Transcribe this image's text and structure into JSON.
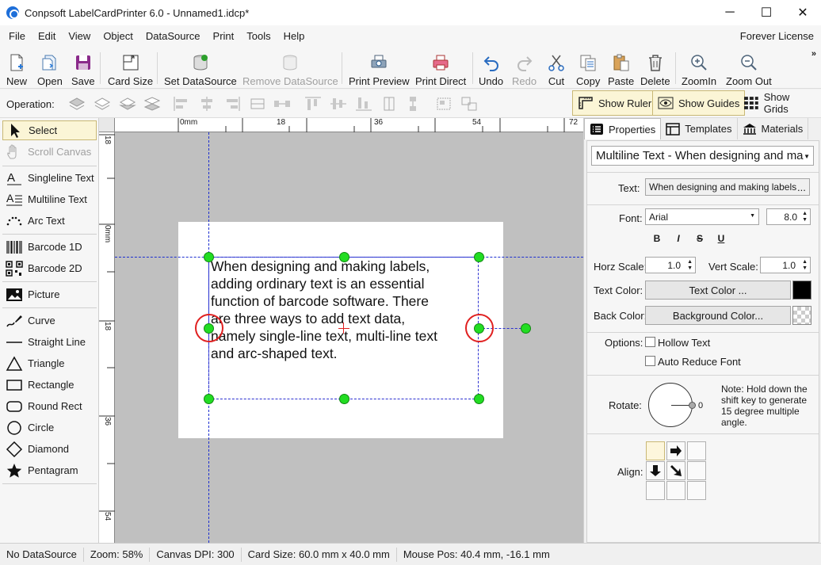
{
  "window": {
    "title": "Conpsoft LabelCardPrinter 6.0 - Unnamed1.idcp*",
    "minimize": "─",
    "maximize": "☐",
    "close": "✕"
  },
  "menu": {
    "items": [
      "File",
      "Edit",
      "View",
      "Object",
      "DataSource",
      "Print",
      "Tools",
      "Help"
    ],
    "license": "Forever License"
  },
  "toolbar": {
    "new": "New",
    "open": "Open",
    "save": "Save",
    "card_size": "Card Size",
    "set_datasource": "Set DataSource",
    "remove_datasource": "Remove DataSource",
    "print_preview": "Print Preview",
    "print_direct": "Print Direct",
    "undo": "Undo",
    "redo": "Redo",
    "cut": "Cut",
    "copy": "Copy",
    "paste": "Paste",
    "delete": "Delete",
    "zoom_in": "ZoomIn",
    "zoom_out": "Zoom Out",
    "more": "»"
  },
  "operation": {
    "label": "Operation:",
    "show_ruler": "Show Ruler",
    "show_guides": "Show Guides",
    "show_grids": "Show Grids"
  },
  "tools": {
    "select": "Select",
    "scroll_canvas": "Scroll Canvas",
    "singleline_text": "Singleline Text",
    "multiline_text": "Multiline Text",
    "arc_text": "Arc Text",
    "barcode_1d": "Barcode 1D",
    "barcode_2d": "Barcode 2D",
    "picture": "Picture",
    "curve": "Curve",
    "straight_line": "Straight Line",
    "triangle": "Triangle",
    "rectangle": "Rectangle",
    "round_rect": "Round Rect",
    "circle": "Circle",
    "diamond": "Diamond",
    "pentagram": "Pentagram"
  },
  "ruler": {
    "top_labels": [
      "0mm",
      "18",
      "36",
      "54",
      "72"
    ],
    "left_labels": [
      "18",
      "0mm",
      "18",
      "36",
      "54"
    ]
  },
  "canvas": {
    "label_text": "When designing and making labels,\nadding ordinary text is an essential\nfunction of barcode software. There\nare three ways to add text data,\nnamely single-line text, multi-line text\nand arc-shaped text."
  },
  "panel": {
    "tabs": [
      "Properties",
      "Templates",
      "Materials"
    ],
    "object": "Multiline Text - When designing and ma",
    "text_label": "Text:",
    "text_value": "When designing and making labels",
    "text_more": "...",
    "font_label": "Font:",
    "font_value": "Arial",
    "font_size": "8.0",
    "format": [
      "B",
      "I",
      "S",
      "U"
    ],
    "horz_scale_label": "Horz Scale:",
    "horz_scale": "1.0",
    "vert_scale_label": "Vert Scale:",
    "vert_scale": "1.0",
    "text_color_label": "Text Color:",
    "text_color_btn": "Text Color ...",
    "text_color": "#000000",
    "back_color_label": "Back Color:",
    "back_color_btn": "Background Color...",
    "options_label": "Options:",
    "hollow_text": "Hollow Text",
    "auto_reduce": "Auto Reduce Font",
    "rotate_label": "Rotate:",
    "rotate_value": "0",
    "note": "Note: Hold down the shift key to generate 15 degree multiple angle.",
    "align_label": "Align:"
  },
  "status": {
    "datasource": "No DataSource",
    "zoom": "Zoom: 58%",
    "dpi": "Canvas DPI: 300",
    "card_size": "Card Size: 60.0 mm x 40.0 mm",
    "mouse_pos": "Mouse Pos: 40.4 mm, -16.1 mm"
  }
}
